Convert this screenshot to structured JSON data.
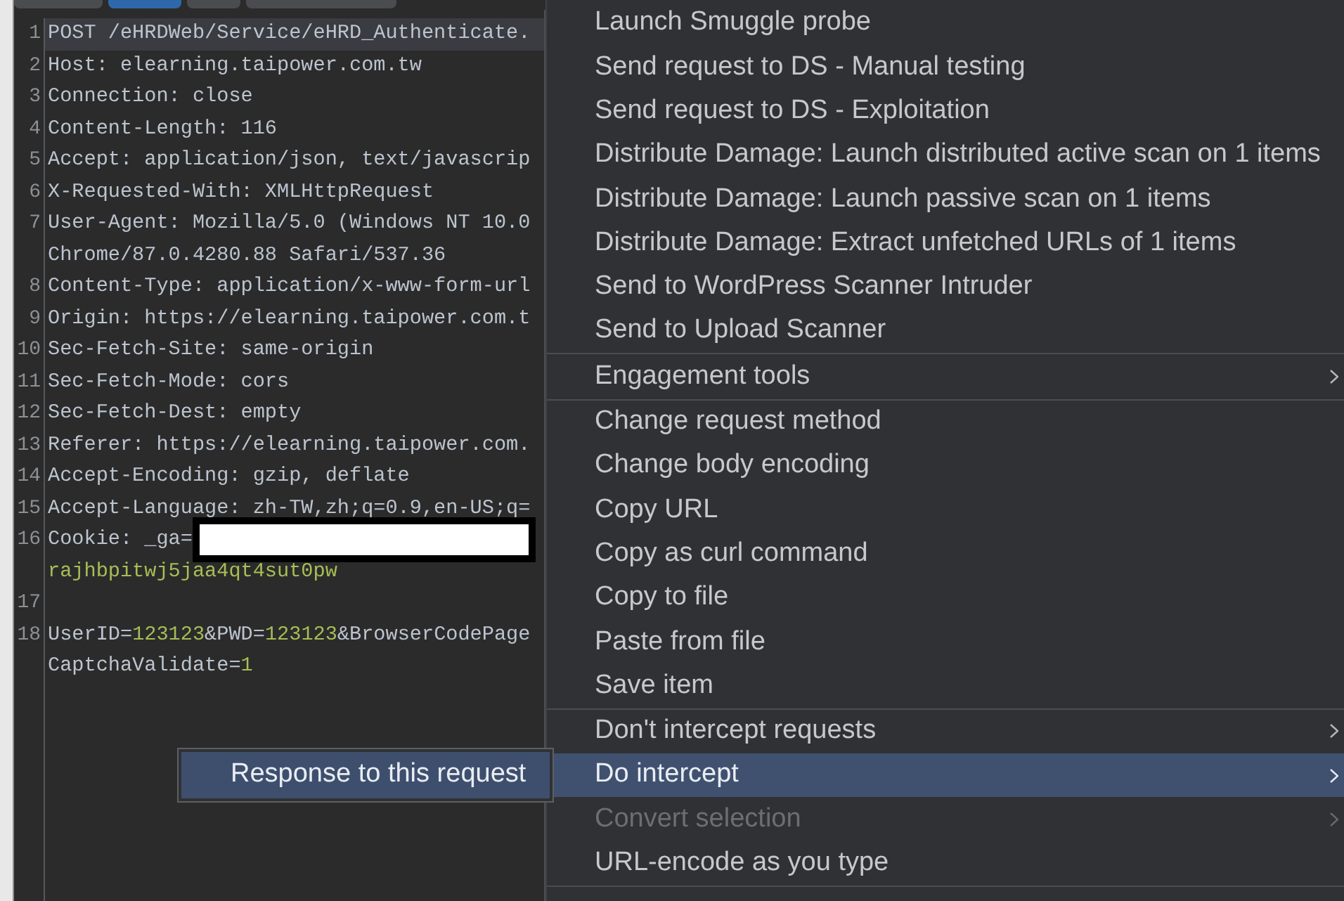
{
  "tabs": [
    {
      "selected": false
    },
    {
      "selected": true
    },
    {
      "selected": false
    },
    {
      "selected": false
    }
  ],
  "editor": {
    "lines": [
      {
        "number": "1",
        "current": true,
        "rows": [
          {
            "segments": [
              {
                "kind": "plain",
                "text": "POST /eHRDWeb/Service/eHRD_Authenticate."
              }
            ]
          }
        ]
      },
      {
        "number": "2",
        "current": false,
        "rows": [
          {
            "segments": [
              {
                "kind": "plain",
                "text": "Host: elearning.taipower.com.tw"
              }
            ]
          }
        ]
      },
      {
        "number": "3",
        "current": false,
        "rows": [
          {
            "segments": [
              {
                "kind": "plain",
                "text": "Connection: close"
              }
            ]
          }
        ]
      },
      {
        "number": "4",
        "current": false,
        "rows": [
          {
            "segments": [
              {
                "kind": "plain",
                "text": "Content-Length: 116"
              }
            ]
          }
        ]
      },
      {
        "number": "5",
        "current": false,
        "rows": [
          {
            "segments": [
              {
                "kind": "plain",
                "text": "Accept: application/json, text/javascrip"
              }
            ]
          }
        ]
      },
      {
        "number": "6",
        "current": false,
        "rows": [
          {
            "segments": [
              {
                "kind": "plain",
                "text": "X-Requested-With: XMLHttpRequest"
              }
            ]
          }
        ]
      },
      {
        "number": "7",
        "current": false,
        "rows": [
          {
            "segments": [
              {
                "kind": "plain",
                "text": "User-Agent: Mozilla/5.0 (Windows NT 10.0"
              }
            ]
          },
          {
            "segments": [
              {
                "kind": "plain",
                "text": "Chrome/87.0.4280.88 Safari/537.36"
              }
            ]
          }
        ]
      },
      {
        "number": "8",
        "current": false,
        "rows": [
          {
            "segments": [
              {
                "kind": "plain",
                "text": "Content-Type: application/x-www-form-url"
              }
            ]
          }
        ]
      },
      {
        "number": "9",
        "current": false,
        "rows": [
          {
            "segments": [
              {
                "kind": "plain",
                "text": "Origin: https://elearning.taipower.com.t"
              }
            ]
          }
        ]
      },
      {
        "number": "10",
        "current": false,
        "rows": [
          {
            "segments": [
              {
                "kind": "plain",
                "text": "Sec-Fetch-Site: same-origin"
              }
            ]
          }
        ]
      },
      {
        "number": "11",
        "current": false,
        "rows": [
          {
            "segments": [
              {
                "kind": "plain",
                "text": "Sec-Fetch-Mode: cors"
              }
            ]
          }
        ]
      },
      {
        "number": "12",
        "current": false,
        "rows": [
          {
            "segments": [
              {
                "kind": "plain",
                "text": "Sec-Fetch-Dest: empty"
              }
            ]
          }
        ]
      },
      {
        "number": "13",
        "current": false,
        "rows": [
          {
            "segments": [
              {
                "kind": "plain",
                "text": "Referer: https://elearning.taipower.com."
              }
            ]
          }
        ]
      },
      {
        "number": "14",
        "current": false,
        "rows": [
          {
            "segments": [
              {
                "kind": "plain",
                "text": "Accept-Encoding: gzip, deflate"
              }
            ]
          }
        ]
      },
      {
        "number": "15",
        "current": false,
        "rows": [
          {
            "segments": [
              {
                "kind": "plain",
                "text": "Accept-Language: zh-TW,zh;q=0.9,en-US;q="
              }
            ]
          }
        ]
      },
      {
        "number": "16",
        "current": false,
        "rows": [
          {
            "segments": [
              {
                "kind": "plain",
                "text": "Cookie: _ga="
              },
              {
                "kind": "redacted"
              }
            ]
          },
          {
            "segments": [
              {
                "kind": "value",
                "text": "rajhbpitwj5jaa4qt4sut0pw"
              }
            ]
          }
        ]
      },
      {
        "number": "17",
        "current": false
      },
      {
        "number": "18",
        "current": false,
        "rows": [
          {
            "segments": [
              {
                "kind": "plain",
                "text": "UserID="
              },
              {
                "kind": "value",
                "text": "123123"
              },
              {
                "kind": "plain",
                "text": "&PWD="
              },
              {
                "kind": "value",
                "text": "123123"
              },
              {
                "kind": "plain",
                "text": "&BrowserCodePage"
              }
            ]
          },
          {
            "segments": [
              {
                "kind": "plain",
                "text": "CaptchaValidate="
              },
              {
                "kind": "value",
                "text": "1"
              }
            ]
          }
        ]
      }
    ]
  },
  "context_menu": {
    "sections": [
      {
        "items": [
          {
            "label": "Launch Smuggle probe",
            "submenu": false,
            "selected": false,
            "disabled": false
          },
          {
            "label": "Send request to DS - Manual testing",
            "submenu": false,
            "selected": false,
            "disabled": false
          },
          {
            "label": "Send request to DS - Exploitation",
            "submenu": false,
            "selected": false,
            "disabled": false
          },
          {
            "label": "Distribute Damage: Launch distributed active scan on 1 items",
            "submenu": false,
            "selected": false,
            "disabled": false
          },
          {
            "label": "Distribute Damage: Launch passive scan on 1 items",
            "submenu": false,
            "selected": false,
            "disabled": false
          },
          {
            "label": "Distribute Damage: Extract unfetched URLs of 1 items",
            "submenu": false,
            "selected": false,
            "disabled": false
          },
          {
            "label": "Send to WordPress Scanner Intruder",
            "submenu": false,
            "selected": false,
            "disabled": false
          },
          {
            "label": "Send to Upload Scanner",
            "submenu": false,
            "selected": false,
            "disabled": false
          }
        ]
      },
      {
        "items": [
          {
            "label": "Engagement tools",
            "submenu": true,
            "selected": false,
            "disabled": false
          }
        ]
      },
      {
        "items": [
          {
            "label": "Change request method",
            "submenu": false,
            "selected": false,
            "disabled": false
          },
          {
            "label": "Change body encoding",
            "submenu": false,
            "selected": false,
            "disabled": false
          },
          {
            "label": "Copy URL",
            "submenu": false,
            "selected": false,
            "disabled": false
          },
          {
            "label": "Copy as curl command",
            "submenu": false,
            "selected": false,
            "disabled": false
          },
          {
            "label": "Copy to file",
            "submenu": false,
            "selected": false,
            "disabled": false
          },
          {
            "label": "Paste from file",
            "submenu": false,
            "selected": false,
            "disabled": false
          },
          {
            "label": "Save item",
            "submenu": false,
            "selected": false,
            "disabled": false
          }
        ]
      },
      {
        "items": [
          {
            "label": "Don't intercept requests",
            "submenu": true,
            "selected": false,
            "disabled": false
          },
          {
            "label": "Do intercept",
            "submenu": true,
            "selected": true,
            "disabled": false
          },
          {
            "label": "Convert selection",
            "submenu": true,
            "selected": false,
            "disabled": true
          },
          {
            "label": "URL-encode as you type",
            "submenu": false,
            "selected": false,
            "disabled": false
          }
        ]
      }
    ]
  },
  "submenu": {
    "items": [
      {
        "label": "Response to this request",
        "selected": true
      }
    ]
  }
}
